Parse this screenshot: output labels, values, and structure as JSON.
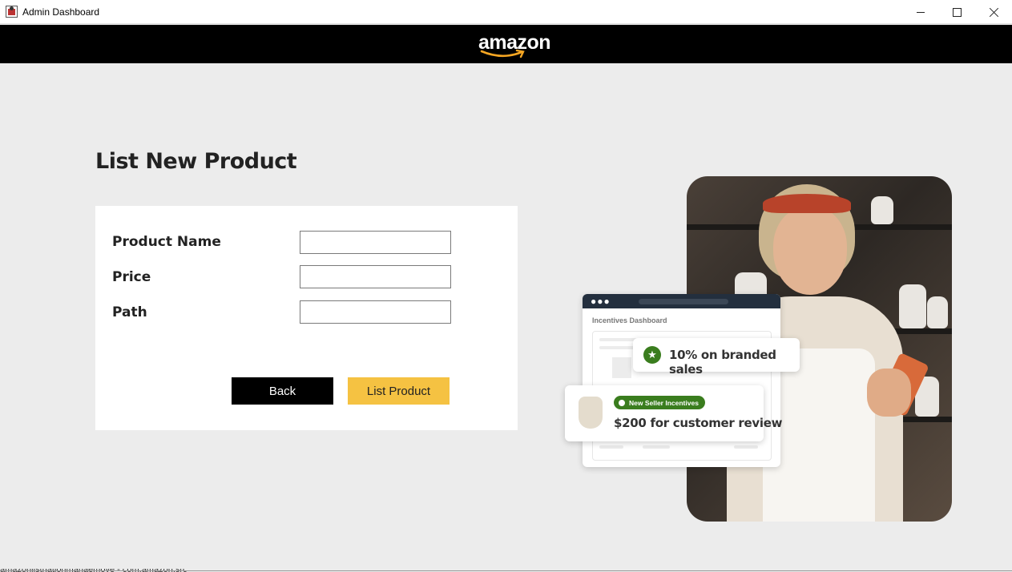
{
  "window": {
    "title": "Admin Dashboard",
    "controls": {
      "minimize": "minimize",
      "maximize": "maximize",
      "close": "close"
    }
  },
  "header": {
    "logo_text": "amazon",
    "background": "#000000"
  },
  "page": {
    "title": "List New Product"
  },
  "form": {
    "fields": [
      {
        "label": "Product Name",
        "value": "",
        "placeholder": ""
      },
      {
        "label": "Price",
        "value": "",
        "placeholder": ""
      },
      {
        "label": "Path",
        "value": "",
        "placeholder": ""
      }
    ],
    "back_label": "Back",
    "submit_label": "List Product",
    "colors": {
      "back": "#000000",
      "submit": "#f5c242"
    }
  },
  "illustration": {
    "dashboard_title": "Incentives Dashboard",
    "badge_sales": "10% on branded sales",
    "pill_label": "New Seller Incentives",
    "badge_review": "$200 for customer review",
    "accent": "#3a7d1e"
  },
  "status": {
    "text": "amazonlistnationmanaemove - com.amazon.src"
  }
}
